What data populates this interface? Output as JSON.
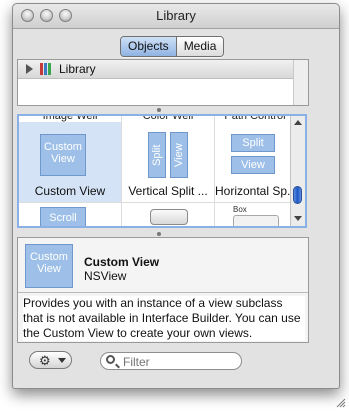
{
  "window": {
    "title": "Library"
  },
  "tabs": [
    {
      "label": "Objects",
      "selected": true
    },
    {
      "label": "Media",
      "selected": false
    }
  ],
  "tree": {
    "item_label": "Library"
  },
  "grid": {
    "columns": [
      {
        "header": "Image Well"
      },
      {
        "header": "Color Well"
      },
      {
        "header": "Path Control"
      }
    ],
    "items": [
      {
        "label": "Custom View",
        "tile": "Custom View",
        "selected": true
      },
      {
        "label": "Vertical Split ...",
        "tile_a": "Split",
        "tile_b": "View"
      },
      {
        "label": "Horizontal Sp...",
        "tile_a": "Split",
        "tile_b": "View"
      }
    ],
    "row2": [
      {
        "tile": "Scroll"
      },
      {
        "tile": ""
      },
      {
        "tile": "Box"
      }
    ]
  },
  "info": {
    "preview": "Custom View",
    "name": "Custom View",
    "class_name": "NSView",
    "description": "Provides you with an instance of a view subclass that is not available in Interface Builder.  You can use the Custom View to create your own views."
  },
  "footer": {
    "search_placeholder": "Filter"
  },
  "colors": {
    "selection": "#d4e3f6",
    "tile": "#9ec0e8",
    "focus_ring": "#8bb0e6",
    "segment_on": "#8fb3e2"
  }
}
